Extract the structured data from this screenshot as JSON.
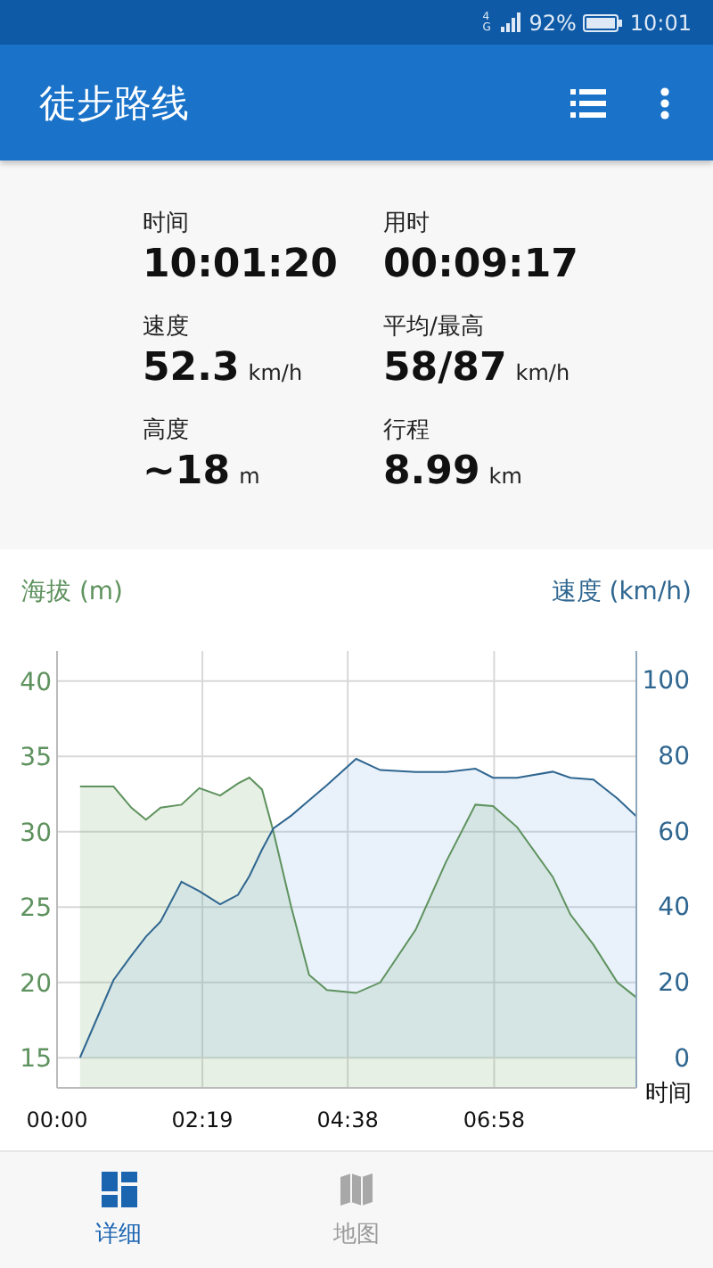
{
  "status_bar": {
    "network": "4G",
    "battery": "92%",
    "time": "10:01"
  },
  "app_bar": {
    "title": "徒步路线"
  },
  "stats": [
    {
      "label": "时间",
      "value": "10:01:20"
    },
    {
      "label": "用时",
      "value": "00:09:17"
    },
    {
      "label": "速度",
      "value": "52.3",
      "unit": "km/h"
    },
    {
      "label": "平均/最高",
      "value": "58/87",
      "unit": "km/h"
    },
    {
      "label": "高度",
      "value": "~18",
      "unit": "m"
    },
    {
      "label": "行程",
      "value": "8.99",
      "unit": "km"
    }
  ],
  "chart": {
    "chart_data": {
      "type": "area",
      "ylabel": "海拔 (m)",
      "y2label": "速度 (km/h)",
      "xlabel": "时间",
      "x": [
        22,
        54,
        71,
        85,
        99,
        119,
        136,
        156,
        173,
        184,
        196,
        207,
        224,
        241,
        258,
        286,
        309,
        343,
        372,
        400,
        417,
        440,
        474,
        491,
        513,
        536,
        554
      ],
      "series": [
        {
          "color": "#5e925e",
          "values": [
            33,
            33,
            31.6,
            30.8,
            31.6,
            31.8,
            32.9,
            32.4,
            33.2,
            33.6,
            32.8,
            30,
            25,
            20.5,
            19.5,
            19.3,
            20,
            23.5,
            28,
            31.8,
            31.7,
            30.3,
            27,
            24.5,
            22.5,
            20,
            19
          ]
        },
        {
          "color": "#2f6690",
          "axis": "y2",
          "values": [
            0,
            20.5,
            27,
            32,
            36,
            46.5,
            44,
            40.5,
            43,
            48,
            55,
            60.6,
            64,
            68,
            72,
            79,
            76,
            75.5,
            75.5,
            76.4,
            74,
            74,
            75.6,
            74,
            73.5,
            68.5,
            63.8
          ]
        }
      ],
      "xlim": [
        0,
        554
      ],
      "ylim": [
        13,
        42
      ],
      "y2lim": [
        -8,
        107.5
      ],
      "xticks": [
        {
          "value": 0,
          "label": "00:00"
        },
        {
          "value": 139,
          "label": "02:19"
        },
        {
          "value": 278,
          "label": "04:38"
        },
        {
          "value": 418,
          "label": "06:58"
        }
      ],
      "grid": true,
      "yticks": [
        15,
        20,
        25,
        30,
        35,
        40
      ],
      "y2ticks": [
        0,
        20,
        40,
        60,
        80,
        100
      ]
    }
  },
  "bottom_nav": [
    {
      "label": "详细",
      "selected": true,
      "kind": "details"
    },
    {
      "label": "地图",
      "selected": false,
      "kind": "map"
    }
  ]
}
